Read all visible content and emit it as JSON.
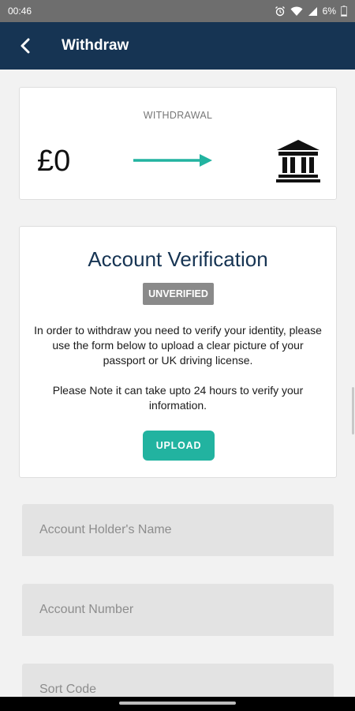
{
  "status_bar": {
    "time": "00:46",
    "battery": "6%"
  },
  "app_bar": {
    "title": "Withdraw",
    "back_icon": "chevron-left-icon"
  },
  "withdrawal_card": {
    "label": "WITHDRAWAL",
    "amount": "£0",
    "arrow_color": "#22b3a0",
    "bank_icon": "bank-icon"
  },
  "verification_card": {
    "title": "Account Verification",
    "status_badge": "UNVERIFIED",
    "instructions": "In order to withdraw you need to verify your identity, please use the form below to upload a clear picture of your passport or UK driving license.",
    "note": "Please Note it can take upto 24 hours to verify your information.",
    "upload_label": "UPLOAD"
  },
  "form": {
    "account_holder_placeholder": "Account Holder's Name",
    "account_number_placeholder": "Account Number",
    "sort_code_placeholder": "Sort Code"
  },
  "colors": {
    "app_bar": "#163453",
    "accent": "#22b3a0",
    "badge": "#8a8a8a"
  }
}
